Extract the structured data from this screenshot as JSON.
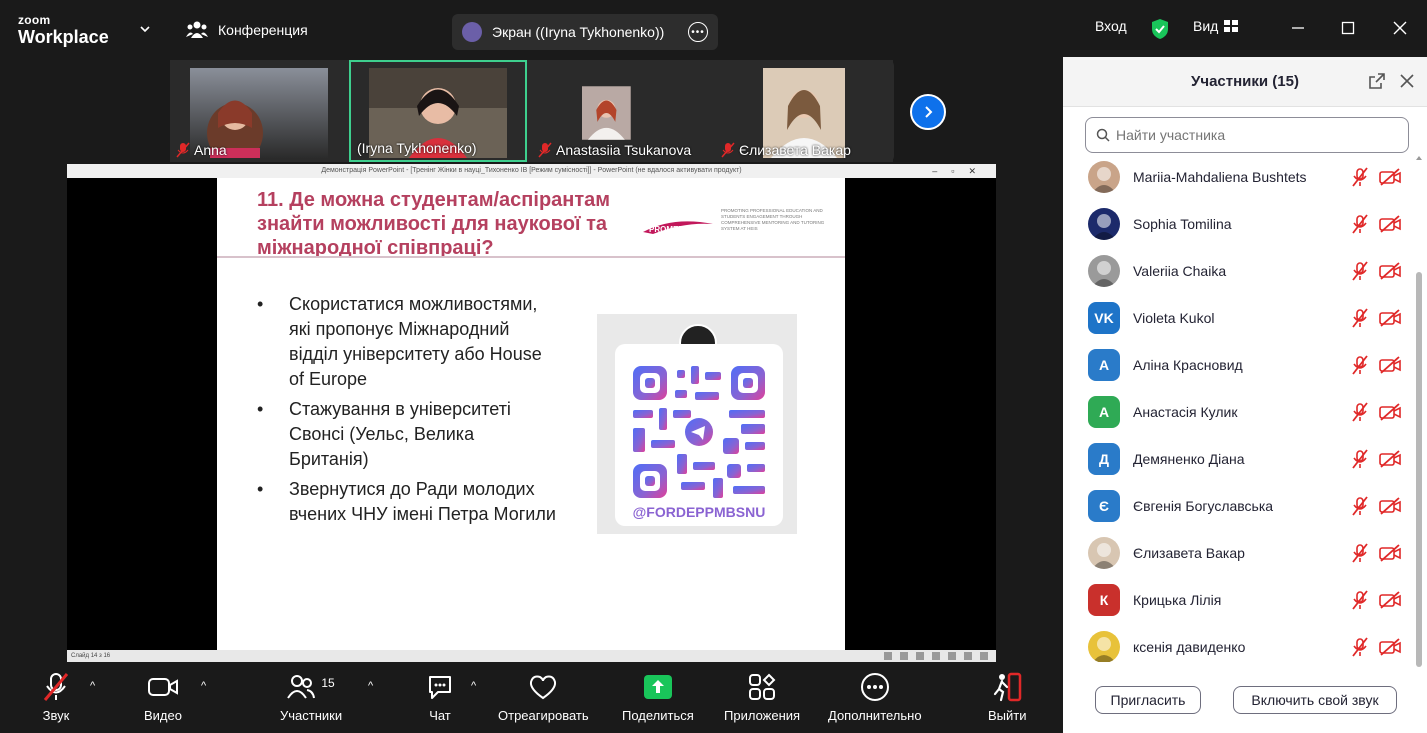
{
  "app": {
    "brand_top": "zoom",
    "brand_main": "Workplace",
    "meeting_label": "Конференция",
    "screen_share_label": "Экран ((Iryna Tykhonenko))",
    "signin_label": "Вход",
    "view_label": "Вид"
  },
  "videos": [
    {
      "name": "Anna",
      "muted": true
    },
    {
      "name": "(Iryna Tykhonenko)",
      "muted": false
    },
    {
      "name": "Anastasiia Tsukanova",
      "muted": true
    },
    {
      "name": "Єлизавета Вакар",
      "muted": true
    }
  ],
  "ppt": {
    "window_title": "Демонстрація PowerPoint - [Тренінг Жінки в науці_Тихоненко ІВ [Режим сумісності]] - PowerPoint (не вдалося активувати продукт)",
    "status_text": "Слайд 14 з 16",
    "slide_title": "11. Де можна студентам/аспірантам знайти можливості для наукової та міжнародної співпраці?",
    "logo_text": "PROMENT",
    "logo_tagline": "PROMOTING PROFESSIONAL EDUCATION AND STUDENTS ENGAGEMENT THROUGH COMPREHENSIVE MENTORING AND TUTORING SYSTEM AT HEIS",
    "bullets": [
      "Скористатися можливостями, які пропонує Міжнародний відділ університету або House of Europe",
      "Стажування в університеті Свонсі (Уельс, Велика Британія)",
      "Звернутися до Ради молодих вчених ЧНУ імені Петра Могили"
    ],
    "qr_handle": "@FORDEPPMBSNU"
  },
  "toolbar": {
    "audio": "Звук",
    "video": "Видео",
    "participants": "Участники",
    "participants_count": "15",
    "chat": "Чат",
    "react": "Отреагировать",
    "share": "Поделиться",
    "apps": "Приложения",
    "more": "Дополнительно",
    "leave": "Выйти"
  },
  "panel": {
    "title": "Участники (15)",
    "search_placeholder": "Найти участника",
    "invite_label": "Пригласить",
    "unmute_label": "Включить свой звук",
    "participants": [
      {
        "name": "Mariia-Mahdaliena Bushtets",
        "avatar": "photo",
        "color": "#c9a489"
      },
      {
        "name": "Sophia Tomilina",
        "avatar": "photo",
        "color": "#1c2a6b"
      },
      {
        "name": "Valeriia Chaika",
        "avatar": "photo",
        "color": "#9a9a9a"
      },
      {
        "name": "Violeta Kukol",
        "avatar": "VK",
        "color": "#1e74c8"
      },
      {
        "name": "Аліна Красновид",
        "avatar": "А",
        "color": "#2a7bc9"
      },
      {
        "name": "Анастасія Кулик",
        "avatar": "А",
        "color": "#2faa55"
      },
      {
        "name": "Демяненко Діана",
        "avatar": "Д",
        "color": "#2a7bc9"
      },
      {
        "name": "Євгенія Богуславська",
        "avatar": "Є",
        "color": "#2a7bc9"
      },
      {
        "name": "Єлизавета Вакар",
        "avatar": "photo",
        "color": "#d8c6b2"
      },
      {
        "name": "Крицька Лілія",
        "avatar": "К",
        "color": "#c9302c"
      },
      {
        "name": "ксенія давиденко",
        "avatar": "photo",
        "color": "#e8c23a"
      }
    ]
  },
  "colors": {
    "accent": "#0e71eb",
    "active_speaker": "#3ecf8e",
    "muted_red": "#e02828",
    "share_green": "#19c55a",
    "slide_title": "#b5405f"
  }
}
